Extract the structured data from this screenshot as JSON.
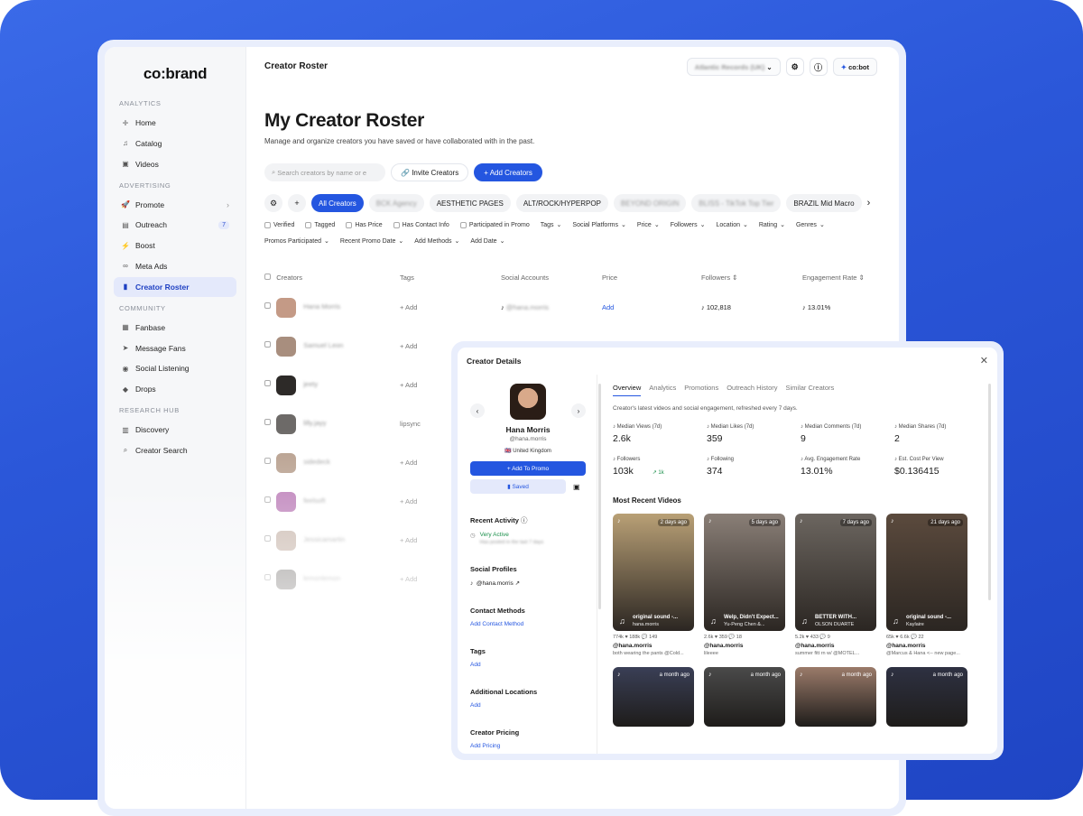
{
  "brand": "co:brand",
  "sidebar": {
    "sections": [
      {
        "title": "ANALYTICS",
        "items": [
          {
            "label": "Home"
          },
          {
            "label": "Catalog"
          },
          {
            "label": "Videos"
          }
        ]
      },
      {
        "title": "ADVERTISING",
        "items": [
          {
            "label": "Promote"
          },
          {
            "label": "Outreach",
            "badge": "7"
          },
          {
            "label": "Boost"
          },
          {
            "label": "Meta Ads"
          },
          {
            "label": "Creator Roster",
            "active": true
          }
        ]
      },
      {
        "title": "COMMUNITY",
        "items": [
          {
            "label": "Fanbase"
          },
          {
            "label": "Message Fans"
          },
          {
            "label": "Social Listening"
          },
          {
            "label": "Drops"
          }
        ]
      },
      {
        "title": "RESEARCH HUB",
        "items": [
          {
            "label": "Discovery"
          },
          {
            "label": "Creator Search"
          }
        ]
      }
    ]
  },
  "header": {
    "title": "Creator Roster",
    "workspace": "Atlantic Records (UK)",
    "cobot": "co:bot"
  },
  "page": {
    "title": "My Creator Roster",
    "subtitle": "Manage and organize creators you have saved or have collaborated with in the past."
  },
  "toolbar": {
    "search_placeholder": "Search creators by name or e",
    "invite": "Invite Creators",
    "add": "+ Add Creators"
  },
  "chips": [
    "All Creators",
    "BCK Agency",
    "AESTHETIC PAGES",
    "ALT/ROCK/HYPERPOP",
    "BEYOND ORIGIN",
    "BLISS - TikTok Top Tier",
    "BRAZIL Mid Macro"
  ],
  "filters": [
    "Verified",
    "Tagged",
    "Has Price",
    "Has Contact Info",
    "Participated in Promo",
    "Tags",
    "Social Platforms",
    "Price",
    "Followers",
    "Location",
    "Rating",
    "Genres",
    "Promos Participated",
    "Recent Promo Date",
    "Add Methods",
    "Add Date"
  ],
  "table": {
    "headers": [
      "Creators",
      "Tags",
      "Social Accounts",
      "Price",
      "Followers",
      "Engagement Rate"
    ],
    "first_row": {
      "name": "Hana Morris",
      "handle": "hana.morris",
      "tag": "+ Add",
      "social": "@hana.morris",
      "price": "Add",
      "followers": "102,818",
      "er": "13.01%"
    },
    "rows": [
      {
        "name": "Samuel Leon",
        "handle": "samuel.leon",
        "tag": "+ Add"
      },
      {
        "name": "jeety",
        "handle": "jeetyofficial",
        "tag": "+ Add"
      },
      {
        "name": "lilly.jayy",
        "handle": "lilly.jayy",
        "tag": "lipsync"
      },
      {
        "name": "sidedeck",
        "handle": "sidedeck",
        "tag": "+ Add"
      },
      {
        "name": "feelsoft",
        "handle": "feelsoft",
        "tag": "+ Add"
      },
      {
        "name": "Jessicamartin",
        "handle": "jessicamartin",
        "tag": "+ Add"
      },
      {
        "name": "lemonlemon",
        "handle": "lemonlemon",
        "tag": "+ Add"
      }
    ]
  },
  "detail": {
    "title": "Creator Details",
    "name": "Hana Morris",
    "handle": "@hana.morris",
    "location": "United Kingdom",
    "promo_button": "+ Add To Promo",
    "saved": "Saved",
    "recent_activity_label": "Recent Activity",
    "activity_status": "Very Active",
    "activity_note": "Has posted in the last 7 days",
    "social_label": "Social Profiles",
    "social_handle": "@hana.morris",
    "contact_label": "Contact Methods",
    "contact_add": "Add Contact Method",
    "tags_label": "Tags",
    "tags_add": "Add",
    "locations_label": "Additional Locations",
    "locations_add": "Add",
    "pricing_label": "Creator Pricing",
    "pricing_add": "Add Pricing",
    "tabs": [
      "Overview",
      "Analytics",
      "Promotions",
      "Outreach History",
      "Similar Creators"
    ],
    "description": "Creator's latest videos and social engagement, refreshed every 7 days.",
    "stats": [
      {
        "k": "Median Views (7d)",
        "v": "2.6k"
      },
      {
        "k": "Median Likes (7d)",
        "v": "359"
      },
      {
        "k": "Median Comments (7d)",
        "v": "9"
      },
      {
        "k": "Median Shares (7d)",
        "v": "2"
      },
      {
        "k": "Followers",
        "v": "103k",
        "delta": "1k"
      },
      {
        "k": "Following",
        "v": "374"
      },
      {
        "k": "Avg. Engagement Rate",
        "v": "13.01%"
      },
      {
        "k": "Est. Cost Per View",
        "v": "$0.136415"
      }
    ],
    "videos_label": "Most Recent Videos",
    "videos": [
      {
        "ago": "2 days ago",
        "cap": "original sound -...",
        "cap2": "hana.morris",
        "meta": "774k   ♥ 188k   💬 149",
        "handle": "@hana.morris",
        "caption": "both wearing the pants @Cold...",
        "color": "#b9a076"
      },
      {
        "ago": "5 days ago",
        "cap": "Welp, Didn't Expect...",
        "cap2": "Yu-Peng Chen &...",
        "meta": "2.6k   ♥ 359   💬 18",
        "handle": "@hana.morris",
        "caption": "lileeee",
        "color": "#8a7f77"
      },
      {
        "ago": "7 days ago",
        "cap": "BETTER WITH...",
        "cap2": "OLSON DUARTE",
        "meta": "5.2k   ♥ 433   💬 9",
        "handle": "@hana.morris",
        "caption": "summer fitt rn w/ @MOTEL...",
        "color": "#6c6660"
      },
      {
        "ago": "21 days ago",
        "cap": "original sound -...",
        "cap2": "Kaylaire",
        "meta": "65k   ♥ 6.6k   💬 22",
        "handle": "@hana.morris",
        "caption": "@Marcus & Hana <-- new page...",
        "color": "#5b4a3d"
      }
    ],
    "more_videos": [
      {
        "ago": "a month ago",
        "color": "#3a3f56"
      },
      {
        "ago": "a month ago",
        "color": "#4a4a4a"
      },
      {
        "ago": "a month ago",
        "color": "#9b7b6a"
      },
      {
        "ago": "a month ago",
        "color": "#2e3142"
      }
    ]
  }
}
